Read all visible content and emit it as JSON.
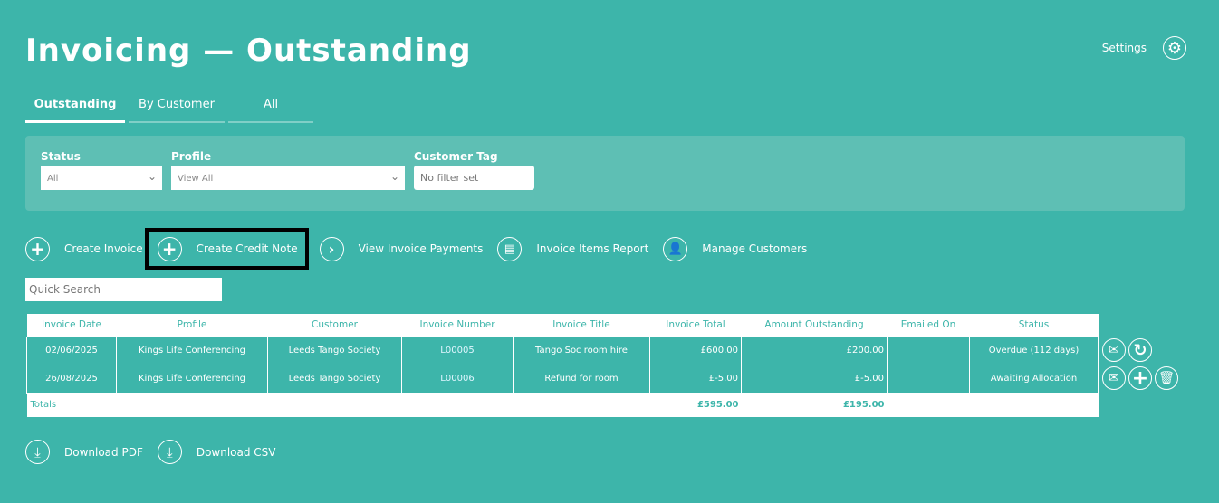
{
  "header": {
    "title": "Invoicing — Outstanding",
    "settings_label": "Settings"
  },
  "tabs": [
    {
      "label": "Outstanding",
      "active": true
    },
    {
      "label": "By Customer"
    },
    {
      "label": "All"
    }
  ],
  "filters": {
    "status_label": "Status",
    "status_value": "All",
    "profile_label": "Profile",
    "profile_value": "View All",
    "tag_label": "Customer Tag",
    "tag_placeholder": "No filter set"
  },
  "actions": [
    {
      "label": "Create Invoice",
      "icon": "plus-icon"
    },
    {
      "label": "Create Credit Note",
      "icon": "plus-icon"
    },
    {
      "label": "View Invoice Payments",
      "icon": "chevron-right-icon"
    },
    {
      "label": "Invoice Items Report",
      "icon": "report-icon"
    },
    {
      "label": "Manage Customers",
      "icon": "user-gear-icon"
    }
  ],
  "search": {
    "placeholder": "Quick Search"
  },
  "table": {
    "columns": [
      "Invoice Date",
      "Profile",
      "Customer",
      "Invoice Number",
      "Invoice Title",
      "Invoice Total",
      "Amount Outstanding",
      "Emailed On",
      "Status"
    ],
    "rows": [
      {
        "date": "02/06/2025",
        "profile": "Kings Life Conferencing",
        "customer": "Leeds Tango Society",
        "number": "L00005",
        "title": "Tango Soc room hire",
        "total": "£600.00",
        "outstanding": "£200.00",
        "emailed": "",
        "status": "Overdue (112 days)"
      },
      {
        "date": "26/08/2025",
        "profile": "Kings Life Conferencing",
        "customer": "Leeds Tango Society",
        "number": "L00006",
        "title": "Refund for room",
        "total": "£-5.00",
        "outstanding": "£-5.00",
        "emailed": "",
        "status": "Awaiting Allocation"
      }
    ],
    "totals": {
      "label": "Totals",
      "total": "£595.00",
      "outstanding": "£195.00"
    }
  },
  "downloads": {
    "pdf": "Download PDF",
    "csv": "Download CSV"
  }
}
